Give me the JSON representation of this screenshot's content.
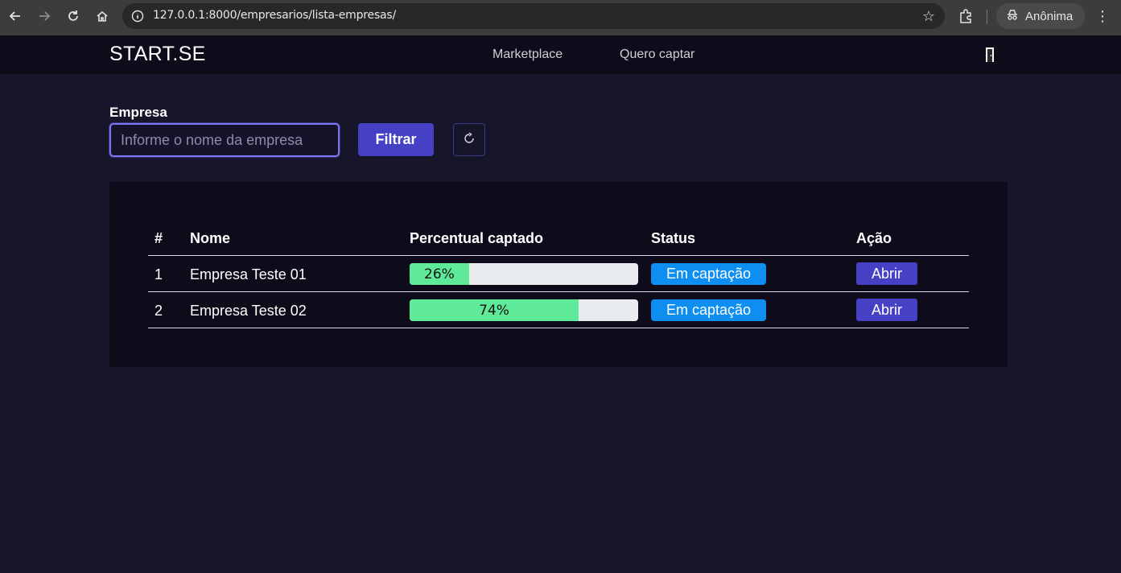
{
  "browser": {
    "url": "127.0.0.1:8000/empresarios/lista-empresas/",
    "profile_label": "Anônima"
  },
  "header": {
    "brand": "START.SE",
    "nav": [
      "Marketplace",
      "Quero captar"
    ]
  },
  "filter": {
    "label": "Empresa",
    "placeholder": "Informe o nome da empresa",
    "button_label": "Filtrar"
  },
  "table": {
    "columns": [
      "#",
      "Nome",
      "Percentual captado",
      "Status",
      "Ação"
    ],
    "rows": [
      {
        "num": "1",
        "name": "Empresa Teste 01",
        "percent_label": "26%",
        "percent": 26,
        "status": "Em captação",
        "action": "Abrir"
      },
      {
        "num": "2",
        "name": "Empresa Teste 02",
        "percent_label": "74%",
        "percent": 74,
        "status": "Em captação",
        "action": "Abrir"
      }
    ]
  },
  "colors": {
    "background": "#17152a",
    "accent": "#4540c4",
    "progress": "#5eea98",
    "status_badge": "#0d8ef0"
  }
}
